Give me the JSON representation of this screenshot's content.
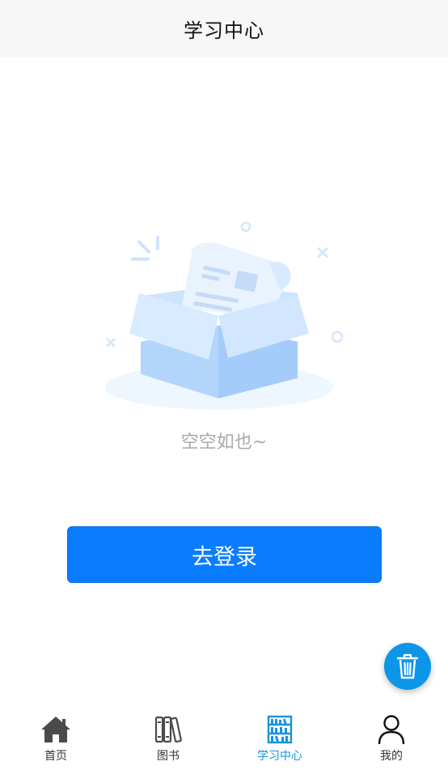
{
  "header": {
    "title": "学习中心"
  },
  "empty_state": {
    "text": "空空如也~",
    "illustration_icon": "empty-box-icon"
  },
  "login_button": {
    "label": "去登录"
  },
  "fab": {
    "icon": "trash-icon",
    "color": "#0c96e8"
  },
  "tabbar": {
    "active_color": "#1296db",
    "items": [
      {
        "label": "首页",
        "icon": "home-icon"
      },
      {
        "label": "图书",
        "icon": "books-icon"
      },
      {
        "label": "学习中心",
        "icon": "bookshelf-icon",
        "active": true
      },
      {
        "label": "我的",
        "icon": "user-icon"
      }
    ]
  }
}
